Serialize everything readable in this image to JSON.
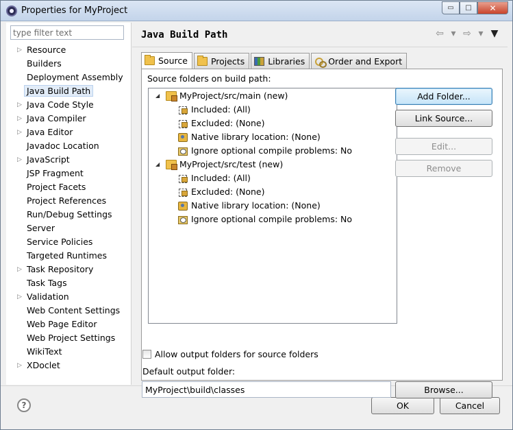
{
  "window": {
    "title": "Properties for MyProject",
    "controls": {
      "minimize": "▭",
      "maximize": "□",
      "close": "✕"
    }
  },
  "left": {
    "filter_placeholder": "type filter text",
    "items": [
      {
        "label": "Resource",
        "expandable": true
      },
      {
        "label": "Builders",
        "expandable": false
      },
      {
        "label": "Deployment Assembly",
        "expandable": false
      },
      {
        "label": "Java Build Path",
        "expandable": false,
        "selected": true
      },
      {
        "label": "Java Code Style",
        "expandable": true
      },
      {
        "label": "Java Compiler",
        "expandable": true
      },
      {
        "label": "Java Editor",
        "expandable": true
      },
      {
        "label": "Javadoc Location",
        "expandable": false
      },
      {
        "label": "JavaScript",
        "expandable": true
      },
      {
        "label": "JSP Fragment",
        "expandable": false
      },
      {
        "label": "Project Facets",
        "expandable": false
      },
      {
        "label": "Project References",
        "expandable": false
      },
      {
        "label": "Run/Debug Settings",
        "expandable": false
      },
      {
        "label": "Server",
        "expandable": false
      },
      {
        "label": "Service Policies",
        "expandable": false
      },
      {
        "label": "Targeted Runtimes",
        "expandable": false
      },
      {
        "label": "Task Repository",
        "expandable": true
      },
      {
        "label": "Task Tags",
        "expandable": false
      },
      {
        "label": "Validation",
        "expandable": true
      },
      {
        "label": "Web Content Settings",
        "expandable": false
      },
      {
        "label": "Web Page Editor",
        "expandable": false
      },
      {
        "label": "Web Project Settings",
        "expandable": false
      },
      {
        "label": "WikiText",
        "expandable": false
      },
      {
        "label": "XDoclet",
        "expandable": true
      }
    ]
  },
  "main": {
    "title": "Java Build Path",
    "nav": {
      "back": "⇦",
      "forward": "⇨",
      "dropdown": "▾",
      "menu": "▼"
    },
    "tabs": [
      {
        "label": "Source",
        "icon": "source-folder-icon",
        "active": true
      },
      {
        "label": "Projects",
        "icon": "projects-folder-icon",
        "active": false
      },
      {
        "label": "Libraries",
        "icon": "libraries-icon",
        "active": false
      },
      {
        "label": "Order and Export",
        "icon": "order-export-icon",
        "active": false
      }
    ],
    "source_label": "Source folders on build path:",
    "tree": [
      {
        "label": "MyProject/src/main (new)",
        "children": [
          {
            "label": "Included: (All)",
            "icon": "included-icon"
          },
          {
            "label": "Excluded: (None)",
            "icon": "excluded-icon"
          },
          {
            "label": "Native library location: (None)",
            "icon": "native-library-icon"
          },
          {
            "label": "Ignore optional compile problems: No",
            "icon": "ignore-problems-icon"
          }
        ]
      },
      {
        "label": "MyProject/src/test (new)",
        "children": [
          {
            "label": "Included: (All)",
            "icon": "included-icon"
          },
          {
            "label": "Excluded: (None)",
            "icon": "excluded-icon"
          },
          {
            "label": "Native library location: (None)",
            "icon": "native-library-icon"
          },
          {
            "label": "Ignore optional compile problems: No",
            "icon": "ignore-problems-icon"
          }
        ]
      }
    ],
    "buttons": {
      "add_folder": "Add Folder...",
      "link_source": "Link Source...",
      "edit": "Edit...",
      "remove": "Remove",
      "browse": "Browse..."
    },
    "allow_output_label": "Allow output folders for source folders",
    "default_output_label": "Default output folder:",
    "default_output_value": "MyProject\\build\\classes"
  },
  "footer": {
    "help": "?",
    "ok": "OK",
    "cancel": "Cancel"
  }
}
